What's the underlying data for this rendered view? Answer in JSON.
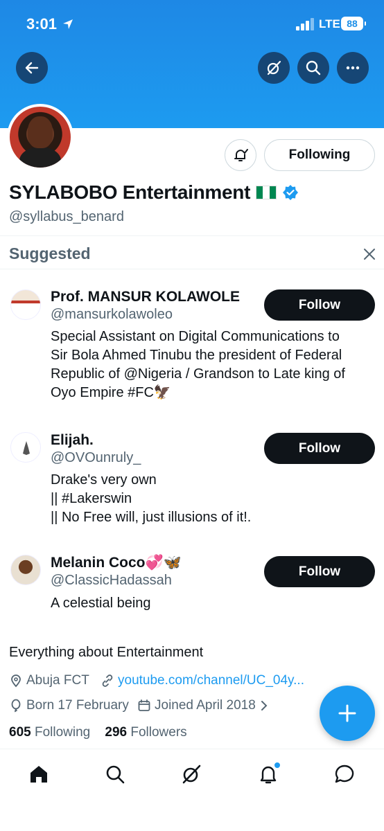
{
  "status_bar": {
    "time": "3:01",
    "network": "LTE",
    "battery": "88"
  },
  "header": {
    "icons": [
      "back-arrow-icon",
      "grok-icon",
      "search-icon",
      "more-icon"
    ]
  },
  "profile": {
    "follow_state_label": "Following",
    "display_name": "SYLABOBO Entertainment",
    "handle": "@syllabus_benard",
    "bio": "Everything about Entertainment",
    "location": "Abuja FCT",
    "website": "youtube.com/channel/UC_04y...",
    "birthday": "Born 17 February",
    "joined": "Joined April 2018",
    "following_count": "605",
    "following_label": "Following",
    "followers_count": "296",
    "followers_label": "Followers"
  },
  "suggested": {
    "title": "Suggested",
    "items": [
      {
        "name": "Prof. MANSUR KOLAWOLE",
        "handle": "@mansurkolawoleo",
        "bio": "Special Assistant on Digital Communications to\nSir Bola Ahmed Tinubu the president of Federal\nRepublic of @Nigeria / Grandson to Late king of\nOyo Empire #FC🦅",
        "button": "Follow"
      },
      {
        "name": "Elijah.",
        "handle": "@OVOunruly_",
        "bio": "Drake's very own\n|| #Lakerswin\n|| No Free will, just illusions of it!.",
        "button": "Follow"
      },
      {
        "name": "Melanin Coco💞🦋",
        "handle": "@ClassicHadassah",
        "bio": "A celestial being",
        "button": "Follow"
      }
    ]
  },
  "colors": {
    "accent": "#1d9bf0",
    "text": "#0f1419",
    "secondary": "#536471"
  }
}
